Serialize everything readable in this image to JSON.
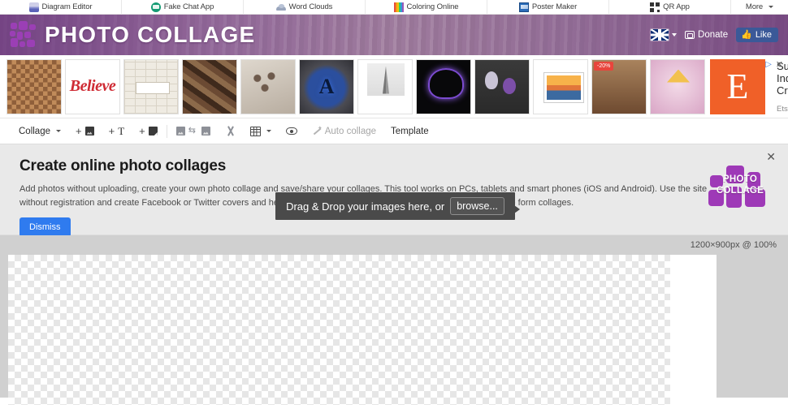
{
  "topnav": {
    "items": [
      {
        "label": "Diagram Editor",
        "icon": "diagram-icon"
      },
      {
        "label": "Fake Chat App",
        "icon": "chat-bubble-icon"
      },
      {
        "label": "Word Clouds",
        "icon": "cloud-icon"
      },
      {
        "label": "Coloring Online",
        "icon": "color-pencils-icon"
      },
      {
        "label": "Poster Maker",
        "icon": "poster-icon"
      },
      {
        "label": "QR App",
        "icon": "qr-code-icon"
      }
    ],
    "more_label": "More"
  },
  "header": {
    "brand_title": "PHOTO COLLAGE",
    "logo_icon": "photo-collage-squares-logo",
    "language_icon": "uk-flag-icon",
    "donate_label": "Donate",
    "donate_icon": "donate-card-icon",
    "like_label": "Like",
    "like_icon": "thumbs-up-icon",
    "brand_color": "#9b3fb5"
  },
  "ad": {
    "headline": "Support Independent Creators",
    "advertiser": "Etsy",
    "brand_letter": "E",
    "brand_color": "#f06028",
    "info_icon": "ad-choices-icon",
    "close_icon": "close-icon",
    "thumbnails": [
      {
        "name": "photo-wall-collage"
      },
      {
        "name": "believe-script-print",
        "text": "Believe"
      },
      {
        "name": "travel-word-grid-print"
      },
      {
        "name": "wooden-blocks-photo"
      },
      {
        "name": "abstract-textured-art"
      },
      {
        "name": "avengers-neon-sign",
        "text": "A"
      },
      {
        "name": "eiffel-tower-music-plaque"
      },
      {
        "name": "neon-unicorn-lamp"
      },
      {
        "name": "purple-roses-print"
      },
      {
        "name": "sunset-window-frame-art"
      },
      {
        "name": "dog-photo-pillow",
        "badge": "-20%"
      },
      {
        "name": "unicorn-sequin-pillow"
      }
    ]
  },
  "toolbar": {
    "collage_label": "Collage",
    "add_image_label": "+",
    "add_text_label": "+",
    "add_shape_label": "+",
    "auto_collage_label": "Auto collage",
    "template_label": "Template",
    "icons": {
      "image": "image-icon",
      "text": "text-icon",
      "shape": "shape-icon",
      "swap": "swap-images-icon",
      "cut": "cut-icon",
      "grid": "grid-icon",
      "preview": "eye-icon",
      "wand": "magic-wand-icon",
      "caret": "chevron-down-icon"
    }
  },
  "info_panel": {
    "title": "Create online photo collages",
    "body": "Add photos without uploading, create your own photo collage and save/share your collages. This tool works on PCs, tablets and smart phones (iOS and Android). Use the site without registration and create Facebook or Twitter covers and header collages. Choose from collage templates or create free form collages.",
    "dismiss_label": "Dismiss",
    "close_icon": "close-icon",
    "watermark_text_line1": "PHOTO",
    "watermark_text_line2": "COLLAGE"
  },
  "drop_tooltip": {
    "message": "Drag & Drop your images here, or",
    "browse_label": "browse..."
  },
  "stage": {
    "size_label": "1200×900px @ 100%"
  }
}
